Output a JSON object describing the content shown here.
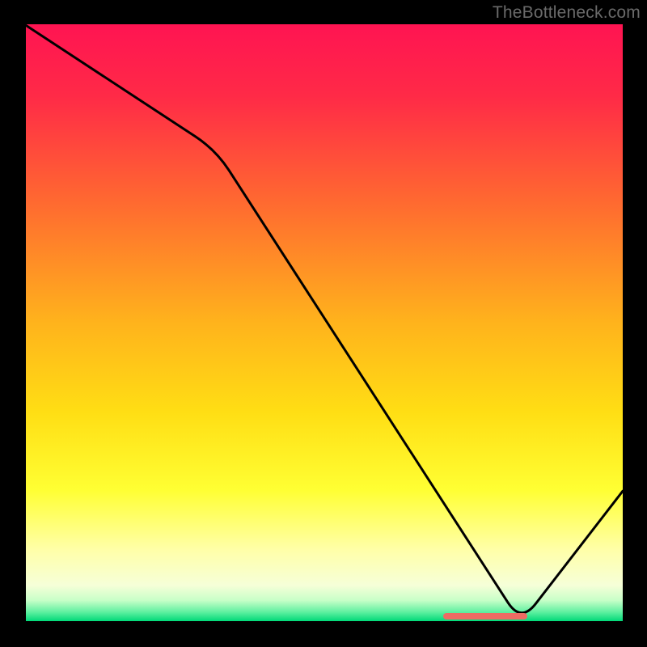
{
  "watermark": "TheBottleneck.com",
  "chart_data": {
    "type": "line",
    "title": "",
    "xlabel": "",
    "ylabel": "",
    "xlim": [
      0,
      100
    ],
    "ylim": [
      0,
      100
    ],
    "series": [
      {
        "name": "curve",
        "x": [
          0,
          32,
          83,
          100
        ],
        "y": [
          100,
          79,
          0,
          22
        ]
      }
    ],
    "highlight_range_x": [
      70,
      84
    ],
    "gradient_stops": [
      {
        "pos": 0,
        "color": "#ff1452"
      },
      {
        "pos": 0.12,
        "color": "#ff2a47"
      },
      {
        "pos": 0.3,
        "color": "#ff6a30"
      },
      {
        "pos": 0.5,
        "color": "#ffb31c"
      },
      {
        "pos": 0.65,
        "color": "#ffde14"
      },
      {
        "pos": 0.78,
        "color": "#ffff33"
      },
      {
        "pos": 0.88,
        "color": "#ffffa8"
      },
      {
        "pos": 0.94,
        "color": "#f6ffd8"
      },
      {
        "pos": 0.965,
        "color": "#c8ffc8"
      },
      {
        "pos": 0.985,
        "color": "#5ef0a0"
      },
      {
        "pos": 1.0,
        "color": "#00d978"
      }
    ]
  }
}
